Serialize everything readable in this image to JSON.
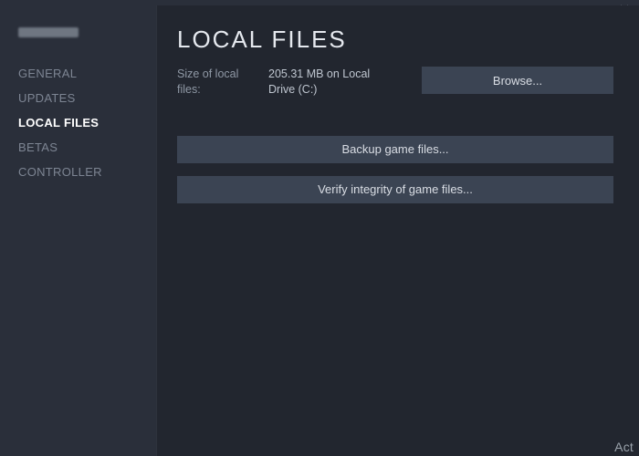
{
  "sidebar": {
    "items": [
      {
        "label": "GENERAL"
      },
      {
        "label": "UPDATES"
      },
      {
        "label": "LOCAL FILES"
      },
      {
        "label": "BETAS"
      },
      {
        "label": "CONTROLLER"
      }
    ],
    "activeIndex": 2
  },
  "main": {
    "title": "LOCAL FILES",
    "sizeLabel": "Size of local files:",
    "sizeValue": "205.31 MB on Local Drive (C:)",
    "browse": "Browse...",
    "backup": "Backup game files...",
    "verify": "Verify integrity of game files..."
  },
  "corner": "Act"
}
